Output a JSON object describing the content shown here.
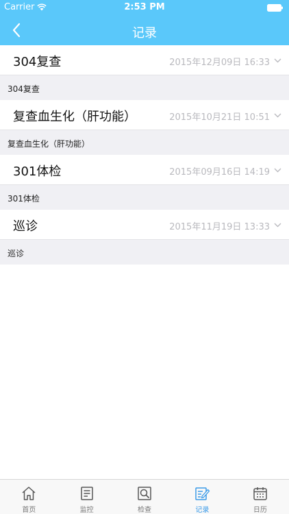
{
  "status_bar": {
    "carrier": "Carrier",
    "time": "2:53 PM"
  },
  "nav": {
    "title": "记录"
  },
  "records": [
    {
      "title": "304复查",
      "date": "2015年12月09日 16:33",
      "detail": "304复查"
    },
    {
      "title": "复查血生化（肝功能）",
      "date": "2015年10月21日 10:51",
      "detail": "复查血生化（肝功能）"
    },
    {
      "title": "301体检",
      "date": "2015年09月16日 14:19",
      "detail": "301体检"
    },
    {
      "title": "巡诊",
      "date": "2015年11月19日 13:33",
      "detail": "巡诊"
    }
  ],
  "tabs": [
    {
      "label": "首页",
      "icon": "home-icon"
    },
    {
      "label": "监控",
      "icon": "monitor-icon"
    },
    {
      "label": "检查",
      "icon": "search-icon"
    },
    {
      "label": "记录",
      "icon": "edit-icon"
    },
    {
      "label": "日历",
      "icon": "calendar-icon"
    }
  ],
  "colors": {
    "accent": "#5ac8fa",
    "active_tab": "#3a9ae8",
    "date_gray": "#b9b9be"
  }
}
